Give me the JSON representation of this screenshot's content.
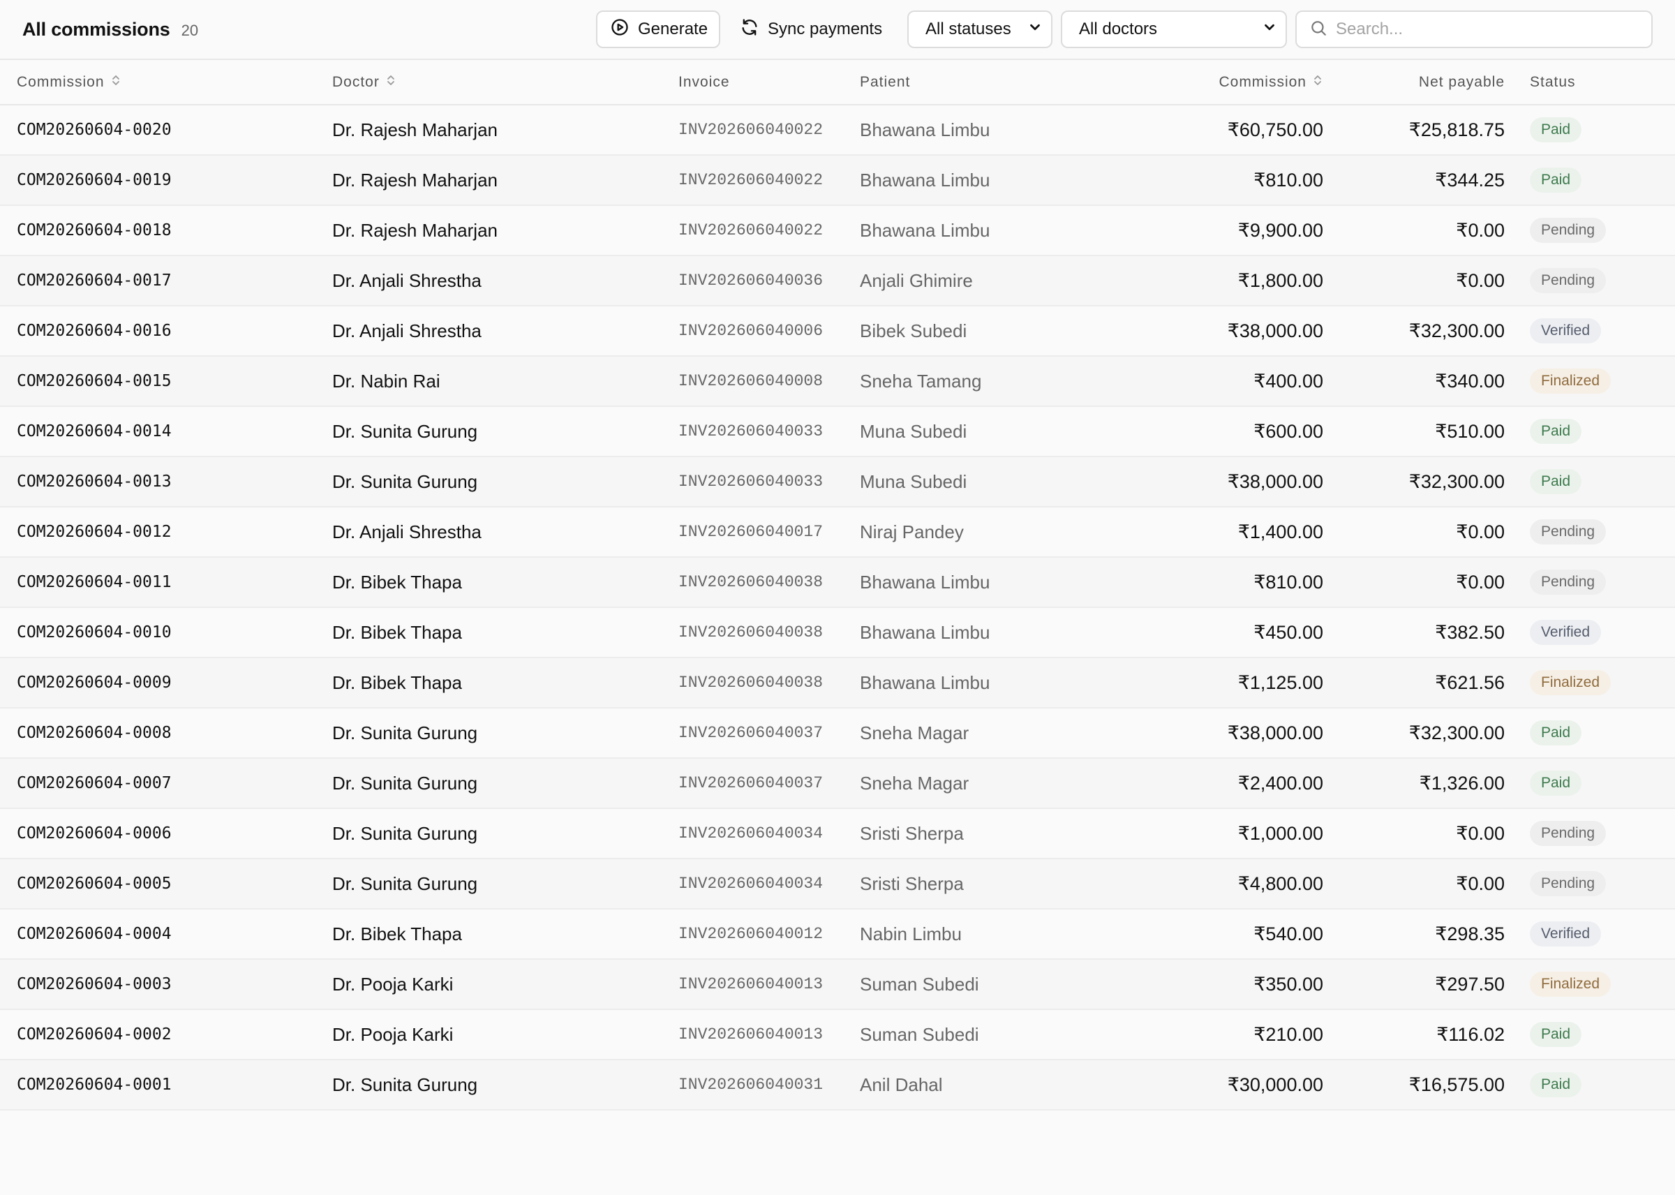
{
  "header": {
    "title": "All commissions",
    "count": "20",
    "generate_label": "Generate",
    "sync_label": "Sync payments",
    "status_filter": "All statuses",
    "doctor_filter": "All doctors",
    "search_placeholder": "Search..."
  },
  "table": {
    "columns": {
      "commission": "Commission",
      "doctor": "Doctor",
      "invoice": "Invoice",
      "patient": "Patient",
      "amount": "Commission",
      "net": "Net payable",
      "status": "Status"
    },
    "rows": [
      {
        "id": "COM20260604-0020",
        "doctor": "Dr. Rajesh Maharjan",
        "invoice": "INV202606040022",
        "patient": "Bhawana Limbu",
        "amount": "₹60,750.00",
        "net": "₹25,818.75",
        "status": "Paid"
      },
      {
        "id": "COM20260604-0019",
        "doctor": "Dr. Rajesh Maharjan",
        "invoice": "INV202606040022",
        "patient": "Bhawana Limbu",
        "amount": "₹810.00",
        "net": "₹344.25",
        "status": "Paid"
      },
      {
        "id": "COM20260604-0018",
        "doctor": "Dr. Rajesh Maharjan",
        "invoice": "INV202606040022",
        "patient": "Bhawana Limbu",
        "amount": "₹9,900.00",
        "net": "₹0.00",
        "status": "Pending"
      },
      {
        "id": "COM20260604-0017",
        "doctor": "Dr. Anjali Shrestha",
        "invoice": "INV202606040036",
        "patient": "Anjali Ghimire",
        "amount": "₹1,800.00",
        "net": "₹0.00",
        "status": "Pending"
      },
      {
        "id": "COM20260604-0016",
        "doctor": "Dr. Anjali Shrestha",
        "invoice": "INV202606040006",
        "patient": "Bibek Subedi",
        "amount": "₹38,000.00",
        "net": "₹32,300.00",
        "status": "Verified"
      },
      {
        "id": "COM20260604-0015",
        "doctor": "Dr. Nabin Rai",
        "invoice": "INV202606040008",
        "patient": "Sneha Tamang",
        "amount": "₹400.00",
        "net": "₹340.00",
        "status": "Finalized"
      },
      {
        "id": "COM20260604-0014",
        "doctor": "Dr. Sunita Gurung",
        "invoice": "INV202606040033",
        "patient": "Muna Subedi",
        "amount": "₹600.00",
        "net": "₹510.00",
        "status": "Paid"
      },
      {
        "id": "COM20260604-0013",
        "doctor": "Dr. Sunita Gurung",
        "invoice": "INV202606040033",
        "patient": "Muna Subedi",
        "amount": "₹38,000.00",
        "net": "₹32,300.00",
        "status": "Paid"
      },
      {
        "id": "COM20260604-0012",
        "doctor": "Dr. Anjali Shrestha",
        "invoice": "INV202606040017",
        "patient": "Niraj Pandey",
        "amount": "₹1,400.00",
        "net": "₹0.00",
        "status": "Pending"
      },
      {
        "id": "COM20260604-0011",
        "doctor": "Dr. Bibek Thapa",
        "invoice": "INV202606040038",
        "patient": "Bhawana Limbu",
        "amount": "₹810.00",
        "net": "₹0.00",
        "status": "Pending"
      },
      {
        "id": "COM20260604-0010",
        "doctor": "Dr. Bibek Thapa",
        "invoice": "INV202606040038",
        "patient": "Bhawana Limbu",
        "amount": "₹450.00",
        "net": "₹382.50",
        "status": "Verified"
      },
      {
        "id": "COM20260604-0009",
        "doctor": "Dr. Bibek Thapa",
        "invoice": "INV202606040038",
        "patient": "Bhawana Limbu",
        "amount": "₹1,125.00",
        "net": "₹621.56",
        "status": "Finalized"
      },
      {
        "id": "COM20260604-0008",
        "doctor": "Dr. Sunita Gurung",
        "invoice": "INV202606040037",
        "patient": "Sneha Magar",
        "amount": "₹38,000.00",
        "net": "₹32,300.00",
        "status": "Paid"
      },
      {
        "id": "COM20260604-0007",
        "doctor": "Dr. Sunita Gurung",
        "invoice": "INV202606040037",
        "patient": "Sneha Magar",
        "amount": "₹2,400.00",
        "net": "₹1,326.00",
        "status": "Paid"
      },
      {
        "id": "COM20260604-0006",
        "doctor": "Dr. Sunita Gurung",
        "invoice": "INV202606040034",
        "patient": "Sristi Sherpa",
        "amount": "₹1,000.00",
        "net": "₹0.00",
        "status": "Pending"
      },
      {
        "id": "COM20260604-0005",
        "doctor": "Dr. Sunita Gurung",
        "invoice": "INV202606040034",
        "patient": "Sristi Sherpa",
        "amount": "₹4,800.00",
        "net": "₹0.00",
        "status": "Pending"
      },
      {
        "id": "COM20260604-0004",
        "doctor": "Dr. Bibek Thapa",
        "invoice": "INV202606040012",
        "patient": "Nabin Limbu",
        "amount": "₹540.00",
        "net": "₹298.35",
        "status": "Verified"
      },
      {
        "id": "COM20260604-0003",
        "doctor": "Dr. Pooja Karki",
        "invoice": "INV202606040013",
        "patient": "Suman Subedi",
        "amount": "₹350.00",
        "net": "₹297.50",
        "status": "Finalized"
      },
      {
        "id": "COM20260604-0002",
        "doctor": "Dr. Pooja Karki",
        "invoice": "INV202606040013",
        "patient": "Suman Subedi",
        "amount": "₹210.00",
        "net": "₹116.02",
        "status": "Paid"
      },
      {
        "id": "COM20260604-0001",
        "doctor": "Dr. Sunita Gurung",
        "invoice": "INV202606040031",
        "patient": "Anil Dahal",
        "amount": "₹30,000.00",
        "net": "₹16,575.00",
        "status": "Paid"
      }
    ]
  },
  "icons": {
    "generate": "play-circle-icon",
    "sync": "refresh-icon",
    "dropdown": "chevron-down-icon",
    "search": "search-icon",
    "sort": "sort-icon"
  },
  "status_colors": {
    "Paid": "#3d7a4c",
    "Pending": "#6a6a6a",
    "Verified": "#555c6b",
    "Finalized": "#8f6b3d"
  }
}
